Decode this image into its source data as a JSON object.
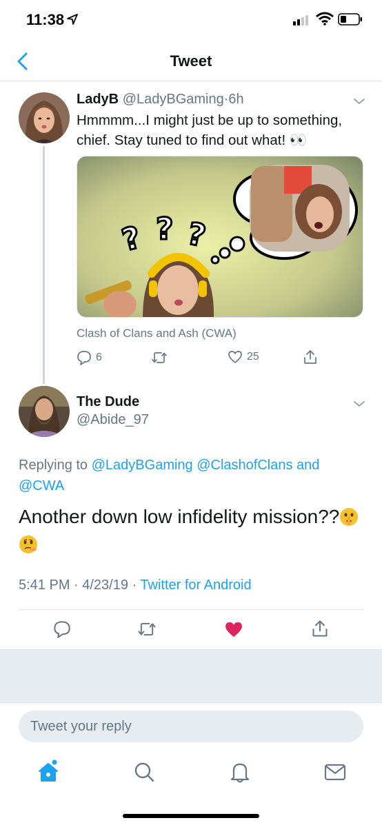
{
  "status_bar": {
    "time": "11:38"
  },
  "nav": {
    "title": "Tweet"
  },
  "tweet1": {
    "name": "LadyB",
    "handle": "@LadyBGaming",
    "separator": "·",
    "time": "6h",
    "text": "Hmmmm...I might just be up to something, chief. Stay tuned to find out what! 👀",
    "media_caption": "Clash of Clans and Ash (CWA)",
    "reply_count": "6",
    "like_count": "25",
    "media_overlay_text": "???"
  },
  "tweet2": {
    "name": "The Dude",
    "handle": "@Abide_97",
    "replying_prefix": "Replying to",
    "replying_links": [
      "@LadyBGaming",
      "@ClashofClans",
      "@CWA"
    ],
    "replying_and": "and",
    "text": "Another down low infidelity mission??",
    "timestamp": "5:41 PM · 4/23/19 ·",
    "source": "Twitter for Android"
  },
  "reply_box": {
    "placeholder": "Tweet your reply"
  },
  "colors": {
    "accent": "#1da1f2",
    "like": "#e0245e",
    "muted": "#657786"
  },
  "icons": [
    "back-chevron-icon",
    "comment-icon",
    "retweet-icon",
    "heart-icon",
    "share-icon",
    "home-icon",
    "search-icon",
    "notifications-bell-icon",
    "messages-envelope-icon"
  ]
}
